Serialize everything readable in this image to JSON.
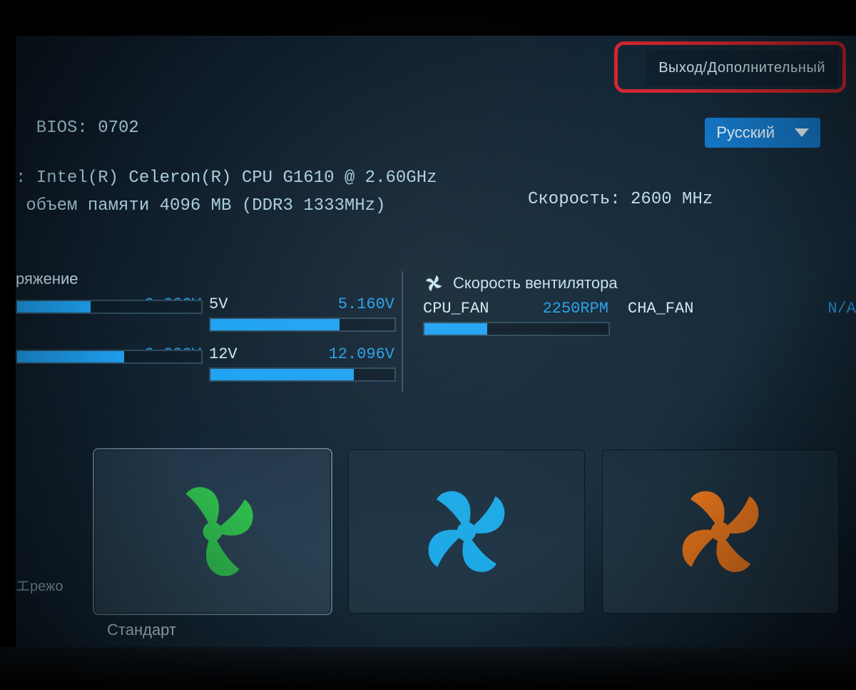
{
  "header": {
    "exit_label": "Выход/Дополнительный",
    "language_label": "Русский"
  },
  "sysinfo": {
    "bios_line": "  BIOS: 0702",
    "cpu_line": ": Intel(R) Celeron(R) CPU G1610 @ 2.60GHz",
    "mem_line": " объем памяти 4096 MB (DDR3 1333MHz)",
    "speed_line": "Скорость: 2600 MHz"
  },
  "sections": {
    "voltage_title": "ряжение",
    "fan_title": "Скорость вентилятора"
  },
  "voltages": {
    "core": {
      "label": "",
      "value": "0.920V",
      "pct": 40
    },
    "v33": {
      "label": "",
      "value": "3.392V",
      "pct": 58
    },
    "v5": {
      "label": "5V",
      "value": "5.160V",
      "pct": 70
    },
    "v12": {
      "label": "12V",
      "value": "12.096V",
      "pct": 78
    }
  },
  "fans": {
    "cpu": {
      "label": "CPU_FAN",
      "value": "2250RPM",
      "pct": 34
    },
    "cha": {
      "label": "CHA_FAN",
      "value": "N/A"
    }
  },
  "modes": {
    "side_label": "エрежо",
    "active_caption": "Стандарт"
  },
  "colors": {
    "mode_normal": "#2fba4d",
    "mode_silent": "#1ea9e6",
    "mode_turbo": "#f07a1e"
  }
}
